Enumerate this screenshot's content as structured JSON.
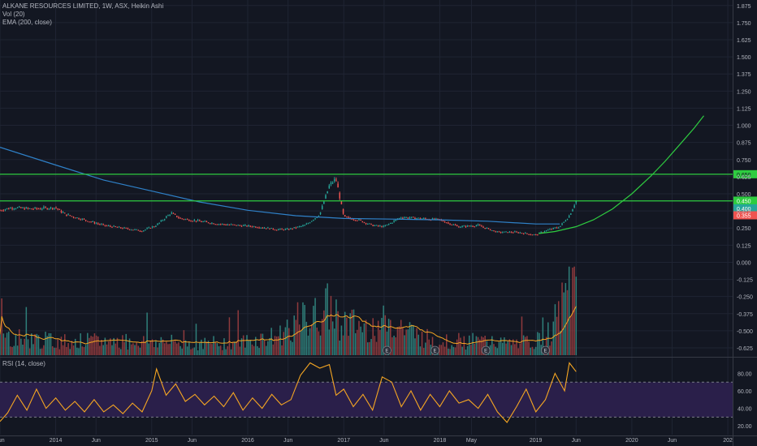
{
  "header": {
    "title": "ALKANE RESOURCES LIMITED, 1W, ASX, Heikin Ashi",
    "volume_label": "Vol (20)",
    "ema_label": "EMA (200, close)",
    "rsi_label": "RSI (14, close)"
  },
  "colors": {
    "background": "#131722",
    "grid": "#1f2433",
    "axis_text": "#b2b5be",
    "candle_up": "#26a69a",
    "candle_down": "#ef5350",
    "volume_up": "#2f7f7a",
    "volume_down": "#8f3a3d",
    "ema_line": "#2f81c8",
    "volume_ma_line": "#f5a623",
    "support_curve": "#2ecc40",
    "horizontal_level": "#2ecc40",
    "rsi_line": "#f5a623",
    "rsi_band": "#2a1f4a"
  },
  "chart_data": [
    {
      "type": "candlestick",
      "title": "ALKANE RESOURCES LIMITED, 1W, ASX, Heikin Ashi",
      "x_axis": {
        "tick_labels": [
          "Jun",
          "2014",
          "Jun",
          "2015",
          "Jun",
          "2016",
          "Jun",
          "2017",
          "Jun",
          "2018",
          "May",
          "2019",
          "Jun",
          "2020",
          "Jun",
          "202"
        ],
        "tick_dates": [
          2013.42,
          2014.0,
          2014.42,
          2015.0,
          2015.42,
          2016.0,
          2016.42,
          2017.0,
          2017.42,
          2018.0,
          2018.33,
          2019.0,
          2019.42,
          2020.0,
          2020.42,
          2021.0
        ],
        "range": [
          2013.42,
          2021.05
        ]
      },
      "y_axis": {
        "tick_labels": [
          "1.875",
          "1.750",
          "1.625",
          "1.500",
          "1.375",
          "1.250",
          "1.125",
          "1.000",
          "0.875",
          "0.750",
          "0.625",
          "0.500",
          "0.375",
          "0.250",
          "0.125",
          "0.000",
          "-0.125",
          "-0.250",
          "-0.375",
          "-0.500",
          "-0.625"
        ],
        "range": [
          -0.69,
          1.915
        ],
        "position": "right"
      },
      "price_series_anchors": {
        "x": [
          2013.42,
          2013.55,
          2013.75,
          2014.0,
          2014.1,
          2014.3,
          2014.5,
          2014.7,
          2014.9,
          2015.05,
          2015.2,
          2015.3,
          2015.5,
          2015.7,
          2015.9,
          2016.1,
          2016.3,
          2016.42,
          2016.6,
          2016.75,
          2016.85,
          2016.92,
          2017.0,
          2017.15,
          2017.3,
          2017.42,
          2017.6,
          2017.8,
          2018.0,
          2018.2,
          2018.4,
          2018.6,
          2018.8,
          2019.0,
          2019.1,
          2019.25,
          2019.35,
          2019.42
        ],
        "y": [
          0.38,
          0.4,
          0.39,
          0.4,
          0.35,
          0.31,
          0.27,
          0.25,
          0.23,
          0.27,
          0.36,
          0.32,
          0.3,
          0.28,
          0.27,
          0.26,
          0.24,
          0.24,
          0.27,
          0.35,
          0.56,
          0.61,
          0.33,
          0.31,
          0.27,
          0.26,
          0.33,
          0.32,
          0.31,
          0.26,
          0.27,
          0.22,
          0.22,
          0.2,
          0.23,
          0.26,
          0.34,
          0.45
        ]
      },
      "series": [
        {
          "name": "EMA (200, close)",
          "type": "line",
          "x": [
            2013.42,
            2014.0,
            2014.5,
            2015.0,
            2015.5,
            2016.0,
            2016.5,
            2017.0,
            2017.5,
            2018.0,
            2018.5,
            2019.0,
            2019.25
          ],
          "y": [
            0.84,
            0.71,
            0.6,
            0.52,
            0.44,
            0.38,
            0.34,
            0.32,
            0.315,
            0.31,
            0.3,
            0.28,
            0.28
          ]
        },
        {
          "name": "support curve",
          "type": "line",
          "x": [
            2019.03,
            2019.2,
            2019.42,
            2019.6,
            2019.8,
            2020.0,
            2020.2,
            2020.35,
            2020.5,
            2020.65,
            2020.75
          ],
          "y": [
            0.21,
            0.225,
            0.26,
            0.31,
            0.39,
            0.5,
            0.63,
            0.74,
            0.86,
            0.98,
            1.07
          ]
        }
      ],
      "horizontal_levels": [
        {
          "y": 0.643,
          "label": "0.650"
        },
        {
          "y": 0.448,
          "label": "0.450"
        }
      ],
      "price_labels": [
        "0.450",
        "0.400",
        "0.355"
      ],
      "volume": {
        "label": "Vol (20)",
        "relative_values_anchors": {
          "x": [
            2013.42,
            2014.0,
            2014.5,
            2015.0,
            2015.5,
            2016.0,
            2016.3,
            2016.5,
            2016.7,
            2016.85,
            2017.0,
            2017.2,
            2017.5,
            2017.8,
            2018.0,
            2018.3,
            2018.5,
            2018.7,
            2019.0,
            2019.15,
            2019.3,
            2019.42
          ],
          "y": [
            0.2,
            0.15,
            0.15,
            0.15,
            0.12,
            0.15,
            0.2,
            0.35,
            0.4,
            0.5,
            0.35,
            0.3,
            0.35,
            0.2,
            0.15,
            0.15,
            0.15,
            0.12,
            0.15,
            0.25,
            0.55,
            0.8
          ]
        },
        "earnings_markers": [
          "E",
          "E",
          "E",
          "E"
        ],
        "earnings_marker_dates": [
          2017.45,
          2017.95,
          2018.48,
          2019.1
        ]
      }
    },
    {
      "type": "line",
      "title": "RSI (14, close)",
      "y_axis": {
        "tick_labels": [
          "80.00",
          "60.00",
          "40.00",
          "20.00"
        ],
        "range": [
          10,
          98
        ],
        "position": "right"
      },
      "overbought": 70,
      "oversold": 30,
      "series": [
        {
          "name": "RSI (14, close)",
          "x": [
            2013.42,
            2013.5,
            2013.6,
            2013.7,
            2013.8,
            2013.9,
            2014.0,
            2014.1,
            2014.2,
            2014.3,
            2014.4,
            2014.5,
            2014.6,
            2014.7,
            2014.8,
            2014.9,
            2015.0,
            2015.05,
            2015.15,
            2015.25,
            2015.35,
            2015.45,
            2015.55,
            2015.65,
            2015.75,
            2015.85,
            2015.95,
            2016.05,
            2016.15,
            2016.25,
            2016.35,
            2016.45,
            2016.55,
            2016.65,
            2016.75,
            2016.85,
            2016.92,
            2017.0,
            2017.1,
            2017.2,
            2017.3,
            2017.4,
            2017.5,
            2017.6,
            2017.7,
            2017.8,
            2017.9,
            2018.0,
            2018.1,
            2018.2,
            2018.3,
            2018.4,
            2018.5,
            2018.6,
            2018.7,
            2018.8,
            2018.9,
            2019.0,
            2019.1,
            2019.2,
            2019.3,
            2019.35,
            2019.42
          ],
          "y": [
            25,
            35,
            55,
            38,
            62,
            40,
            52,
            38,
            48,
            36,
            50,
            36,
            44,
            34,
            46,
            36,
            60,
            85,
            55,
            68,
            48,
            56,
            44,
            54,
            42,
            58,
            38,
            52,
            40,
            56,
            44,
            50,
            78,
            92,
            86,
            90,
            55,
            62,
            42,
            56,
            38,
            76,
            70,
            42,
            60,
            38,
            56,
            42,
            60,
            46,
            50,
            40,
            56,
            36,
            24,
            42,
            62,
            36,
            50,
            80,
            60,
            92,
            82
          ]
        }
      ]
    }
  ]
}
